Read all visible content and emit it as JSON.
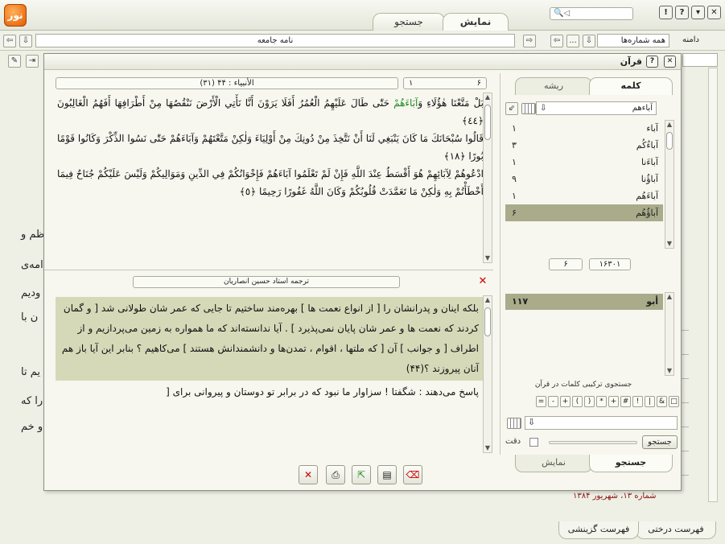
{
  "app": {
    "tabs": [
      "نمایش",
      "جستجو"
    ],
    "top_search_placeholder": "",
    "address_value": "نامه جامعه",
    "scope_label": "دامنه",
    "scope_value": "همه شماره‌ها",
    "more_label": "..."
  },
  "background": {
    "left_text": [
      "ظم و",
      "امه‌ی",
      "ودیم",
      "ن با",
      "یم تا",
      "را که",
      "و خم"
    ],
    "issue": "شماره ۱۳، شهریور ۱۳۸۴",
    "bottom_tabs": [
      "فهرست درختی",
      "فهرست گزینشی"
    ]
  },
  "dialog": {
    "title": "قرآن",
    "verse_ref": "(۳۱) الأنبياء : ۴۴",
    "page_a": "۱",
    "page_b": "۶",
    "verses": [
      "بَلْ مَتَّعْنَا هٰؤُلَاءِ وَ",
      "آبَاءَهُمْ",
      " حَتّٰى طَالَ عَلَيْهِمُ الْعُمُرُ أَفَلَا يَرَوْنَ أَنَّا نَأْتِي الْأَرْضَ نَنْقُصُهَا مِنْ أَطْرَافِهَا أَفَهُمُ الْغَالِبُونَ ﴿٤٤﴾",
      "قَالُوا سُبْحَانَكَ مَا كَانَ يَنْبَغِي لَنَا أَنْ نَتَّخِذَ مِنْ دُونِكَ مِنْ أَوْلِيَاءَ وَلٰكِنْ مَتَّعْتَهُمْ وَآبَاءَهُمْ حَتّٰى نَسُوا الذِّكْرَ وَكَانُوا قَوْمًا بُورًا ﴿١٨﴾",
      "ادْعُوهُمْ لِآبَائِهِمْ هُوَ أَقْسَطُ عِنْدَ اللَّهِ فَإِنْ لَمْ تَعْلَمُوا آبَاءَهُمْ فَإِخْوَانُكُمْ فِي الدِّينِ وَمَوَالِيكُمْ وَلَيْسَ عَلَيْكُمْ جُنَاحٌ فِيمَا أَخْطَأْتُمْ بِهِ وَلٰكِنْ مَا تَعَمَّدَتْ قُلُوبُكُمْ وَكَانَ اللَّهُ غَفُورًا رَحِيمًا ﴿٥﴾"
    ],
    "translation_title": "ترجمه استاد حسین انصاریان",
    "translation_highlight": "بلکه اینان و پدرانشان را [ از انواع نعمت ها ] بهره‌مند ساختیم تا جایی که عمر شان طولانی شد [ و گمان کردند که نعمت ها و عمر شان پایان نمی‌پذیرد ] . آیا ندانسته‌اند که ما همواره به زمین می‌پردازیم و از اطراف [ و جوانب ] آن [ که ملتها ، اقوام ، تمدن‌ها و دانشمندانش هستند ] می‌کاهیم ؟ بنابر این آیا باز هم آنان پیروزند ؟(۴۴)",
    "translation_rest": "پاسخ می‌دهند : شگفتا ! سزاوار ما نبود که در برابر تو دوستان و پیروانی برای ["
  },
  "right_panel": {
    "tabs": [
      "کلمه",
      "ریشه"
    ],
    "word_value": "آباءهم",
    "words": [
      {
        "w": "آباء",
        "c": "۱"
      },
      {
        "w": "آباءُکُم",
        "c": "۳"
      },
      {
        "w": "آباءَنا",
        "c": "۱"
      },
      {
        "w": "آباؤُنا",
        "c": "۹"
      },
      {
        "w": "آباءَهُم",
        "c": "۱"
      },
      {
        "w": "آباؤُهُم",
        "c": "۶"
      }
    ],
    "counter_a": "۱۶۳۰۱",
    "counter_b": "۶",
    "result_word": "أبو",
    "result_count": "۱۱۷",
    "compound_label": "جستجوی ترکیبی کلمات در قرآن",
    "ops": [
      "□",
      "&",
      "|",
      "!",
      "#",
      "+",
      "*",
      "(",
      ")",
      "+",
      "-",
      "="
    ],
    "search_button": "جستجو",
    "accuracy_label": "دقت",
    "bottom_tabs": [
      "نمایش",
      "جستجو"
    ]
  }
}
